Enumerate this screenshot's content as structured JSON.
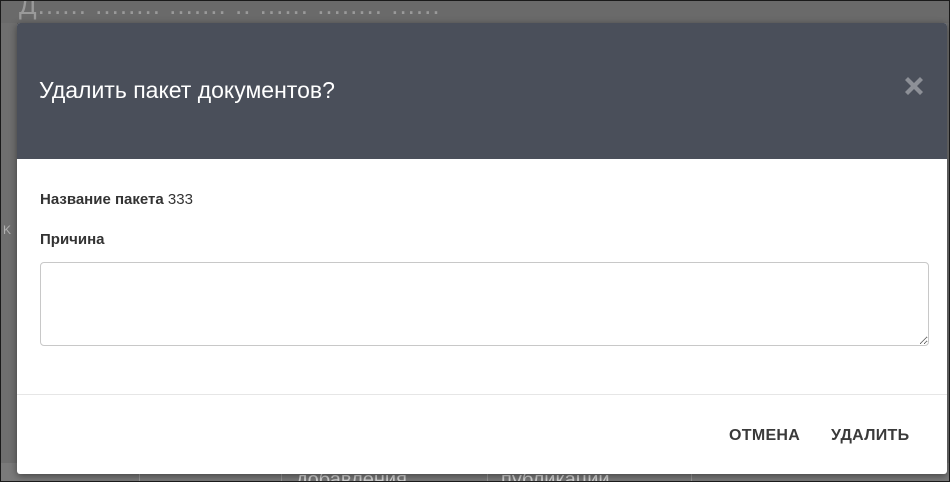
{
  "background": {
    "top_heading_fragment": "Д...... ........ ....... .. ...... ........ ......",
    "bottom_columns": [
      "добавления",
      "публикации"
    ]
  },
  "dialog": {
    "title": "Удалить пакет документов?",
    "close_icon": "close-x-icon",
    "package_label": "Название пакета",
    "package_value": "333",
    "reason_label": "Причина",
    "reason_value": "",
    "cancel_label": "ОТМЕНА",
    "delete_label": "УДАЛИТЬ"
  },
  "colors": {
    "header_bg": "#4a4f5a",
    "overlay": "#5a5a5a",
    "button_text": "#3a3a3a"
  }
}
